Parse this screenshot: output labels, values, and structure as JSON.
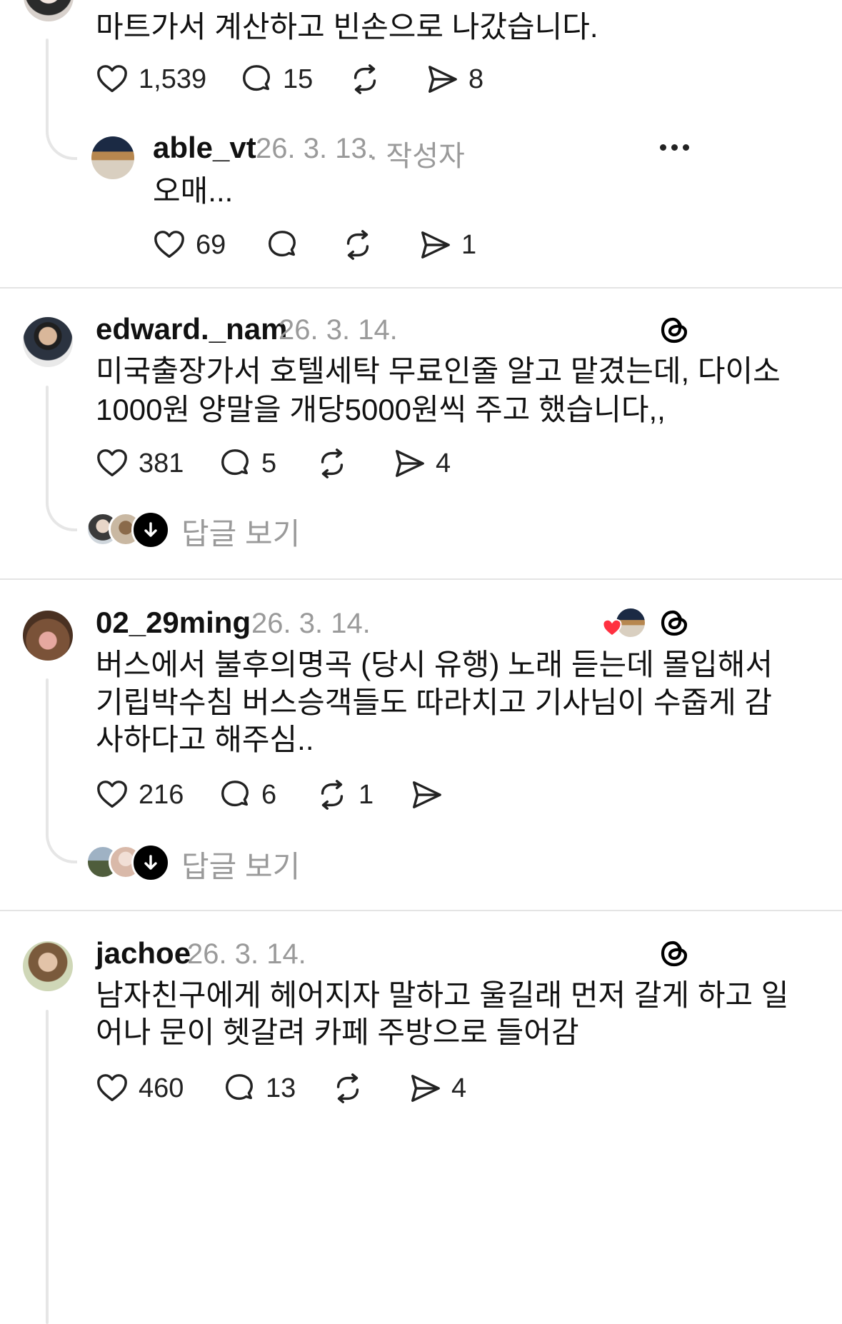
{
  "comments": [
    {
      "text": "마트가서 계산하고 빈손으로 나갔습니다.",
      "likes": "1,539",
      "replies": "15",
      "reposts": "",
      "shares": "8"
    },
    {
      "username": "able_vt",
      "date": "26. 3. 13.",
      "author_tag": "· 작성자",
      "text": "오매...",
      "likes": "69",
      "replies": "",
      "reposts": "",
      "shares": "1"
    },
    {
      "username": "edward._nam",
      "date": "26. 3. 14.",
      "text_lines": [
        "미국출장가서 호텔세탁 무료인줄 알고 맡겼는데, 다이소",
        "1000원 양말을 개당5000원씩 주고 했습니다,,"
      ],
      "likes": "381",
      "replies": "5",
      "reposts": "",
      "shares": "4",
      "view_replies": "답글 보기"
    },
    {
      "username": "02_29ming",
      "date": "26. 3. 14.",
      "text_lines": [
        "버스에서 불후의명곡 (당시 유행) 노래 듣는데 몰입해서",
        "기립박수침 버스승객들도 따라치고 기사님이 수줍게 감",
        "사하다고 해주심.."
      ],
      "likes": "216",
      "replies": "6",
      "reposts": "1",
      "shares": "",
      "view_replies": "답글 보기"
    },
    {
      "username": "jachoe",
      "date": "26. 3. 14.",
      "text_lines": [
        "남자친구에게 헤어지자 말하고 울길래 먼저 갈게 하고 일",
        "어나 문이 헷갈려 카페 주방으로 들어감"
      ],
      "likes": "460",
      "replies": "13",
      "reposts": "",
      "shares": "4"
    }
  ],
  "icons": {
    "like": "heart-outline-icon",
    "reply": "speech-bubble-icon",
    "repost": "repost-arrows-icon",
    "share": "paper-plane-icon",
    "threads": "threads-logo-icon",
    "more": "more-horizontal-icon",
    "view_replies_arrow": "arrow-down-icon"
  },
  "colors": {
    "text": "#111111",
    "muted": "#9a9a9a",
    "divider": "#e4e4e4",
    "heart_red": "#ff3040"
  }
}
